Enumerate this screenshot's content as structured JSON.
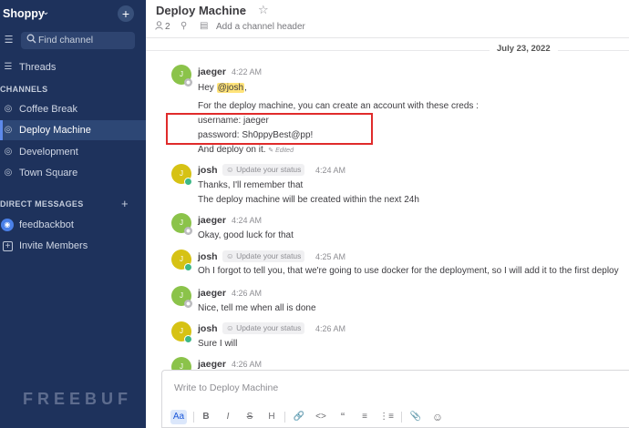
{
  "team": {
    "name": "Shoppy",
    "chevron": "chevron-down-icon",
    "add_label": "+"
  },
  "sidebar": {
    "find_channel": "Find channel",
    "threads": "Threads",
    "channels_header": "CHANNELS",
    "channels": [
      {
        "label": "Coffee Break",
        "active": false
      },
      {
        "label": "Deploy Machine",
        "active": true
      },
      {
        "label": "Development",
        "active": false
      },
      {
        "label": "Town Square",
        "active": false
      }
    ],
    "dm_header": "DIRECT MESSAGES",
    "dm_add": "+",
    "dms": [
      {
        "label": "feedbackbot"
      }
    ],
    "invite": "Invite Members"
  },
  "header": {
    "title": "Deploy Machine",
    "member_count": "2",
    "hint": "Add a channel header"
  },
  "date_separator": "July 23, 2022",
  "messages": {
    "m1": {
      "author": "jaeger",
      "avatar": "J",
      "time": "4:22 AM",
      "hey": "Hey ",
      "mention": "@josh",
      "after_mention": ",",
      "line2": "For the deploy machine, you can create an account with these creds :",
      "line3": "username: jaeger",
      "line4": "password: Sh0ppyBest@pp!",
      "line5": "And deploy on it.",
      "edited": "Edited"
    },
    "m2": {
      "author": "josh",
      "avatar": "J",
      "status": "Update your status",
      "time": "4:24 AM",
      "line1": "Thanks, I'll remember that",
      "line2": "The deploy machine will be created within the next 24h"
    },
    "m3": {
      "author": "jaeger",
      "avatar": "J",
      "time": "4:24 AM",
      "line1": "Okay, good luck for that"
    },
    "m4": {
      "author": "josh",
      "avatar": "J",
      "status": "Update your status",
      "time": "4:25 AM",
      "line1": "Oh I forgot to tell you, that we're going to use docker for the deployment, so I will add it to the first deploy"
    },
    "m5": {
      "author": "jaeger",
      "avatar": "J",
      "time": "4:26 AM",
      "line1": "Nice, tell me when all is done"
    },
    "m6": {
      "author": "josh",
      "avatar": "J",
      "status": "Update your status",
      "time": "4:26 AM",
      "line1": "Sure I will"
    },
    "m7": {
      "author": "jaeger",
      "avatar": "J",
      "time": "4:26 AM"
    }
  },
  "composer": {
    "placeholder": "Write to Deploy Machine",
    "tools": [
      "Aa",
      "B",
      "I",
      "S",
      "H",
      "🔗",
      "<>",
      "“",
      "≡",
      "⋮≡",
      "📎",
      "☺"
    ]
  },
  "watermark": "FREEBUF",
  "colors": {
    "sidebar": "#1e325c",
    "active_item": "#2d4775",
    "mention": "#ffe37a",
    "highlight_box": "#e02b2b",
    "online": "#3db887"
  }
}
